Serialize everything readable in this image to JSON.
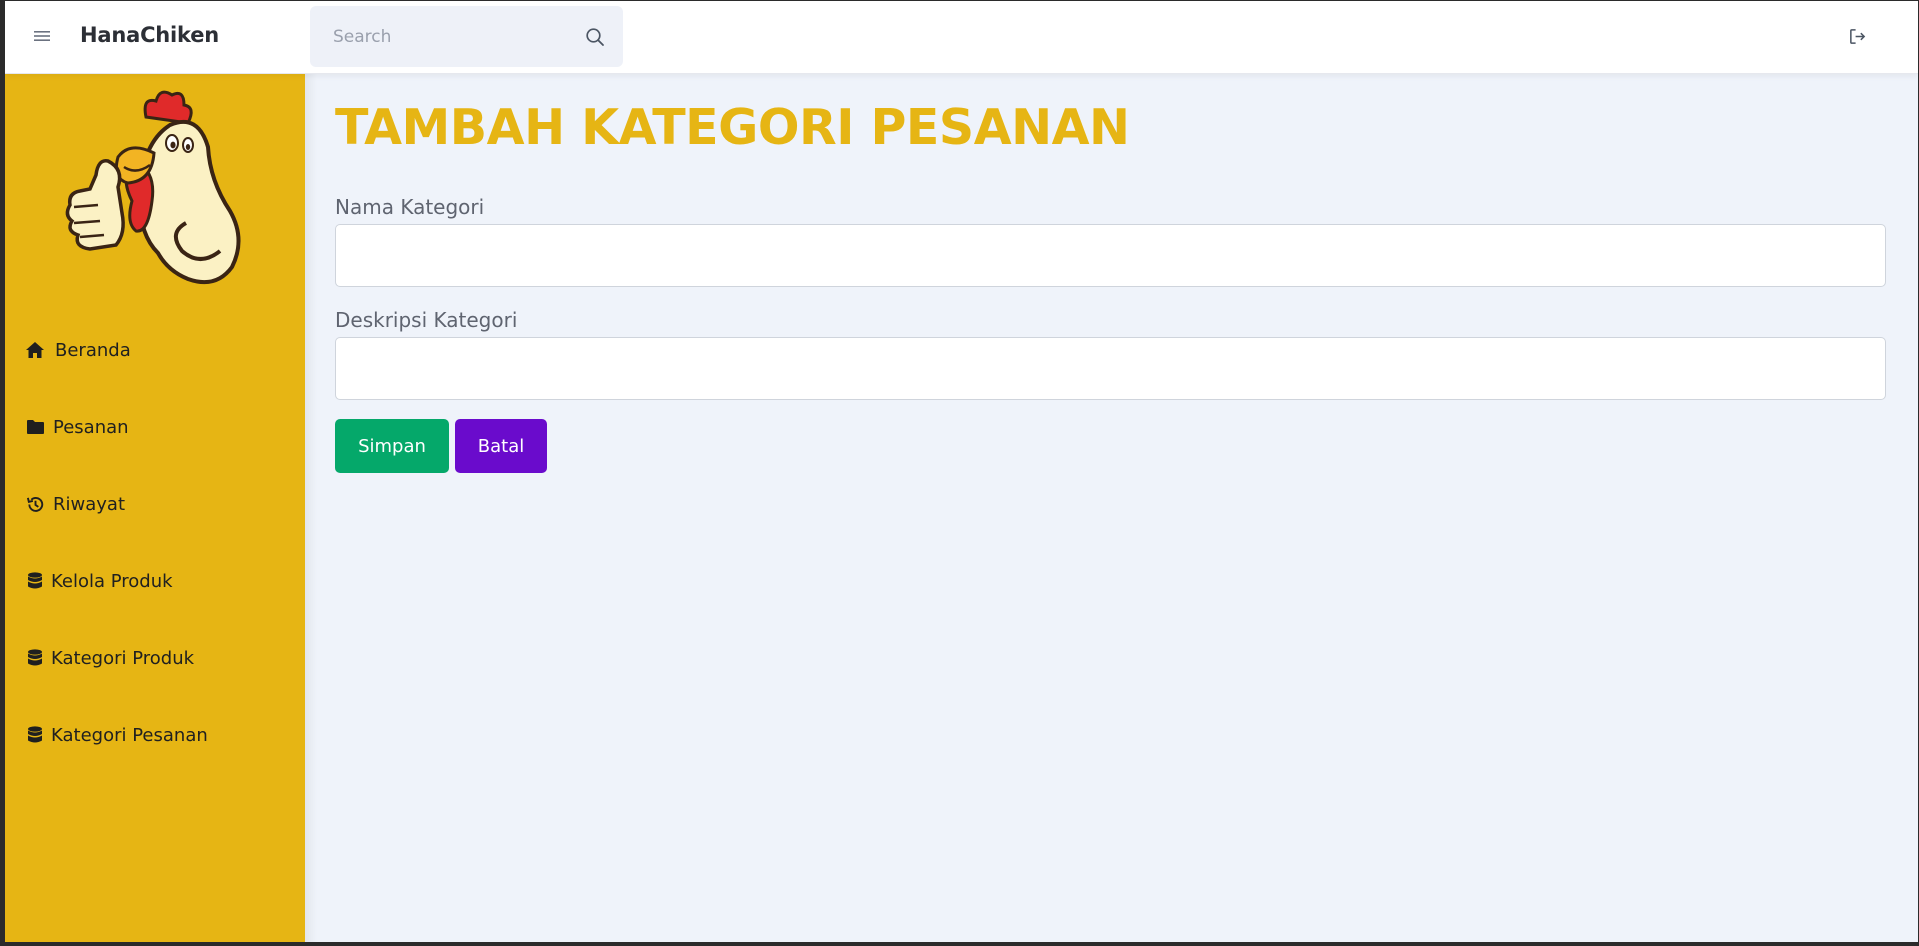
{
  "app": {
    "brand": "HanaChiken"
  },
  "search": {
    "placeholder": "Search",
    "value": ""
  },
  "sidebar": {
    "items": [
      {
        "label": "Beranda",
        "icon": "home-icon"
      },
      {
        "label": "Pesanan",
        "icon": "folder-icon"
      },
      {
        "label": "Riwayat",
        "icon": "history-icon"
      },
      {
        "label": "Kelola Produk",
        "icon": "database-icon"
      },
      {
        "label": "Kategori Produk",
        "icon": "database-icon"
      },
      {
        "label": "Kategori Pesanan",
        "icon": "database-icon"
      }
    ]
  },
  "main": {
    "title": "TAMBAH KATEGORI PESANAN",
    "fields": [
      {
        "label": "Nama Kategori",
        "value": ""
      },
      {
        "label": "Deskripsi Kategori",
        "value": ""
      }
    ],
    "buttons": {
      "save": "Simpan",
      "cancel": "Batal"
    }
  },
  "colors": {
    "accent": "#e6b514",
    "sidebar_bg": "#e6b514",
    "save": "#05a86a",
    "cancel": "#6a0bcc",
    "page_bg": "#eff3fa"
  }
}
